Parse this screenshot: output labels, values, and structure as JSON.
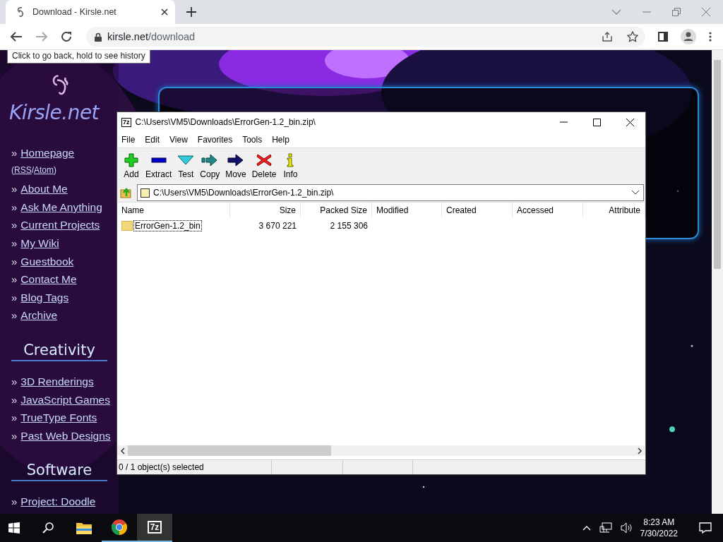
{
  "browser": {
    "tab": {
      "title": "Download - Kirsle.net",
      "selected": true
    },
    "address": {
      "host": "kirsle.net",
      "path": "/download"
    },
    "tooltip": "Click to go back, hold to see history"
  },
  "sidebar": {
    "logo": "Kirsle.net",
    "sections": [
      {
        "items": [
          {
            "kind": "link",
            "bullet": "»",
            "label": "Homepage"
          },
          {
            "kind": "feeds",
            "open": "(",
            "first": "RSS",
            "sep": "/",
            "second": "Atom",
            "close": ")"
          },
          {
            "kind": "link",
            "bullet": "»",
            "label": "About Me"
          },
          {
            "kind": "link",
            "bullet": "»",
            "label": "Ask Me Anything"
          },
          {
            "kind": "link",
            "bullet": "»",
            "label": "Current Projects"
          },
          {
            "kind": "link",
            "bullet": "»",
            "label": "My Wiki"
          },
          {
            "kind": "link",
            "bullet": "»",
            "label": "Guestbook"
          },
          {
            "kind": "link",
            "bullet": "»",
            "label": "Contact Me"
          },
          {
            "kind": "link",
            "bullet": "»",
            "label": "Blog Tags"
          },
          {
            "kind": "link",
            "bullet": "»",
            "label": "Archive"
          }
        ]
      },
      {
        "heading": "Creativity",
        "items": [
          {
            "kind": "link",
            "bullet": "»",
            "label": "3D Renderings"
          },
          {
            "kind": "link",
            "bullet": "»",
            "label": "JavaScript Games"
          },
          {
            "kind": "link",
            "bullet": "»",
            "label": "TrueType Fonts"
          },
          {
            "kind": "link",
            "bullet": "»",
            "label": "Past Web Designs"
          }
        ]
      },
      {
        "heading": "Software",
        "items": [
          {
            "kind": "link",
            "bullet": "»",
            "label": "Project: Doodle"
          }
        ]
      }
    ]
  },
  "archiver": {
    "title": "C:\\Users\\VM5\\Downloads\\ErrorGen-1.2_bin.zip\\",
    "app_badge": "7z",
    "menu": [
      "File",
      "Edit",
      "View",
      "Favorites",
      "Tools",
      "Help"
    ],
    "toolbar": [
      {
        "kind": "add",
        "label": "Add"
      },
      {
        "kind": "extract",
        "label": "Extract"
      },
      {
        "kind": "test",
        "label": "Test"
      },
      {
        "kind": "copy",
        "label": "Copy"
      },
      {
        "kind": "move",
        "label": "Move"
      },
      {
        "kind": "delete",
        "label": "Delete"
      },
      {
        "kind": "info",
        "label": "Info"
      }
    ],
    "path": "C:\\Users\\VM5\\Downloads\\ErrorGen-1.2_bin.zip\\",
    "columns": [
      "Name",
      "Size",
      "Packed Size",
      "Modified",
      "Created",
      "Accessed",
      "Attribute"
    ],
    "rows": [
      {
        "name": "ErrorGen-1.2_bin",
        "size": "3 670 221",
        "packed": "2 155 306",
        "focused": true,
        "selected": false
      }
    ],
    "status": "0 / 1 object(s) selected"
  },
  "taskbar": {
    "apps": [
      {
        "kind": "folder",
        "running": false
      },
      {
        "kind": "chrome",
        "running": true
      },
      {
        "kind": "archiver",
        "label": "7z",
        "running": true,
        "selected": true
      }
    ],
    "time": "8:23 AM",
    "date": "7/30/2022"
  }
}
